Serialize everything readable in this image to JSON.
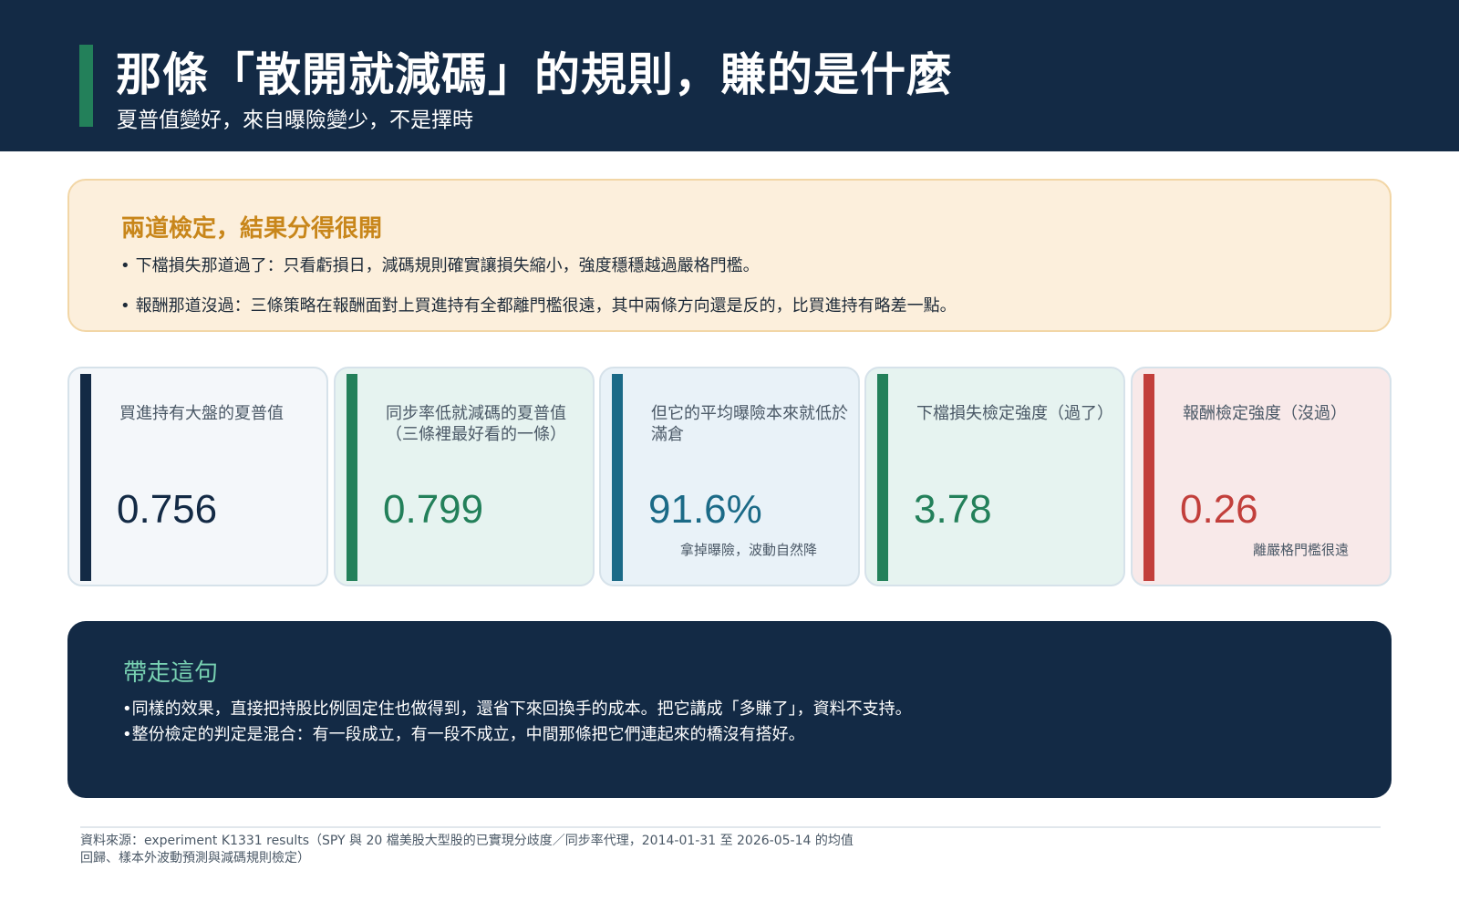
{
  "header": {
    "title": "那條「散開就減碼」的規則，賺的是什麼",
    "subtitle": "夏普值變好，來自曝險變少，不是擇時"
  },
  "summary": {
    "title": "兩道檢定，結果分得很開",
    "bullets": [
      "下檔損失那道過了：只看虧損日，減碼規則確實讓損失縮小，強度穩穩越過嚴格門檻。",
      "報酬那道沒過：三條策略在報酬面對上買進持有全都離門檻很遠，其中兩條方向還是反的，比買進持有略差一點。"
    ]
  },
  "cards": [
    {
      "label": "買進持有大盤的夏普值",
      "value": "0.756",
      "note": ""
    },
    {
      "label": "同步率低就減碼的夏普值（三條裡最好看的一條）",
      "value": "0.799",
      "note": ""
    },
    {
      "label": "但它的平均曝險本來就低於滿倉",
      "value": "91.6%",
      "note": "拿掉曝險，波動自然降"
    },
    {
      "label": "下檔損失檢定強度（過了）",
      "value": "3.78",
      "note": ""
    },
    {
      "label": "報酬檢定強度（沒過）",
      "value": "0.26",
      "note": "離嚴格門檻很遠"
    }
  ],
  "takeaway": {
    "title": "帶走這句",
    "bullets": [
      "同樣的效果，直接把持股比例固定住也做得到，還省下來回換手的成本。把它講成「多賺了」，資料不支持。",
      "整份檢定的判定是混合：有一段成立，有一段不成立，中間那條把它們連起來的橋沒有搭好。"
    ]
  },
  "footer": {
    "source": "資料來源：experiment K1331 results（SPY 與 20 檔美股大型股的已實現分歧度／同步率代理，2014-01-31 至 2026-05-14 的均值回歸、樣本外波動預測與減碼規則檢定）"
  },
  "bullet_glyph": "•",
  "colors": {
    "navy": "#132a45",
    "green": "#23805a",
    "teal": "#1b6a87",
    "red": "#c23f3b",
    "amber": "#c8861a",
    "mint": "#78d1b2"
  }
}
